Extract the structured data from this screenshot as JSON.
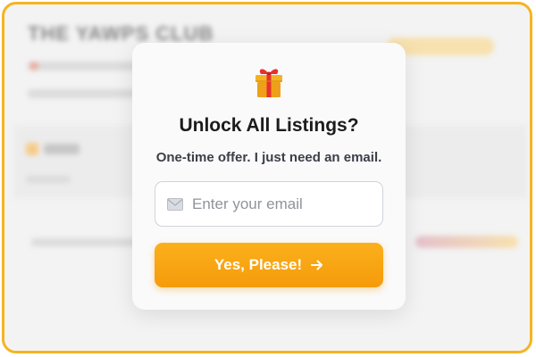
{
  "background": {
    "title": "THE YAWPS CLUB"
  },
  "modal": {
    "icon": "gift-icon",
    "title": "Unlock All Listings?",
    "subtitle": "One-time offer. I just need an email.",
    "email": {
      "icon": "mail-icon",
      "placeholder": "Enter your email",
      "value": ""
    },
    "cta": {
      "label": "Yes, Please!",
      "icon": "arrow-right-icon"
    }
  },
  "colors": {
    "frame_border": "#f5b422",
    "cta_start": "#fbb01b",
    "cta_end": "#f59b0c",
    "title_text": "#1c1c1c"
  }
}
